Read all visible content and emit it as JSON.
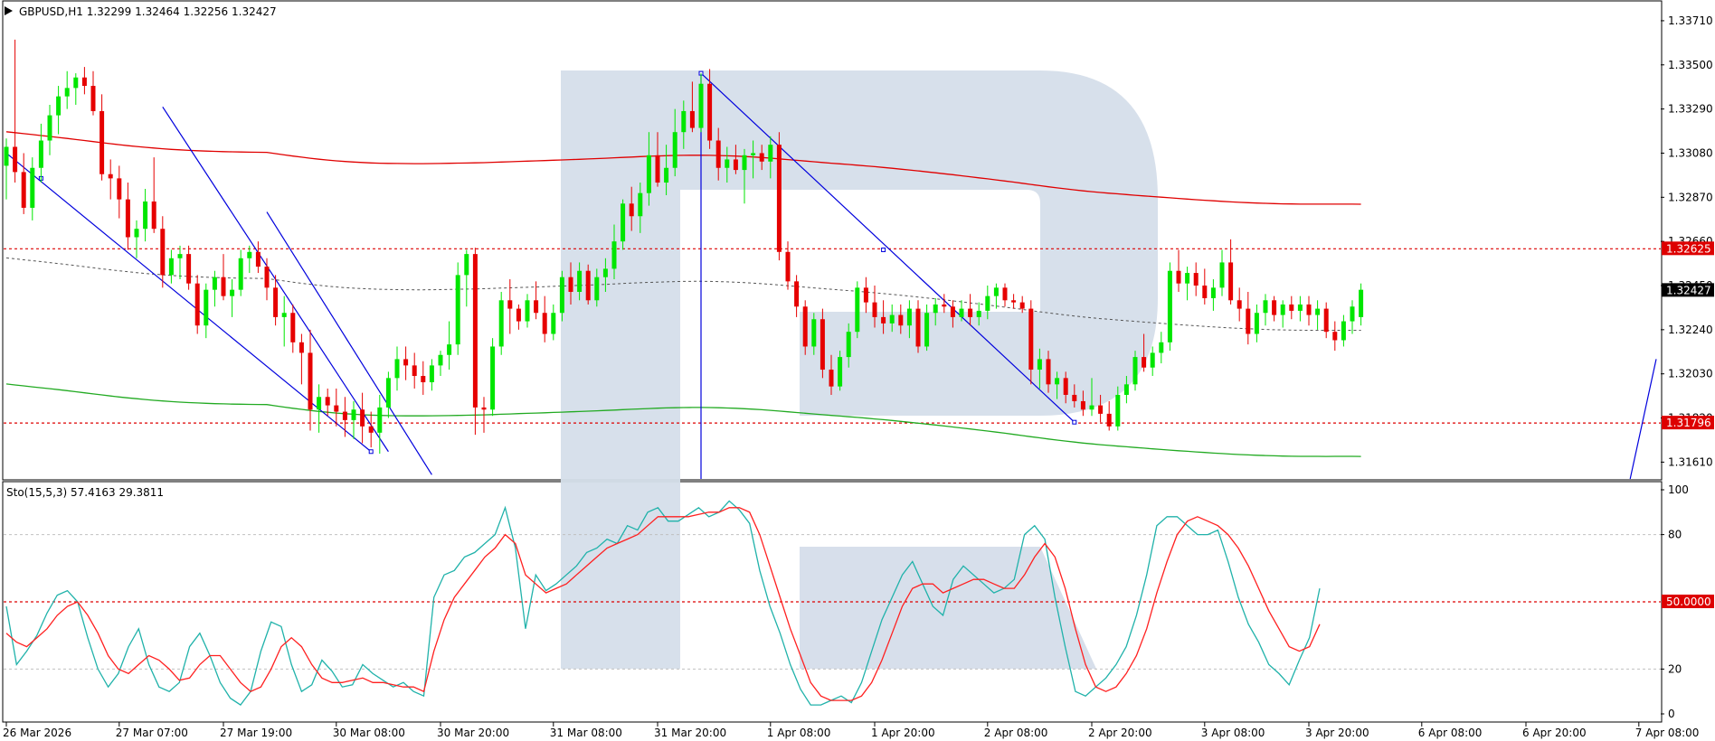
{
  "main_panel": {
    "info_label": "GBPUSD,H1  1.32299 1.32464 1.32256 1.32427",
    "price_ticks": [
      "1.33710",
      "1.33500",
      "1.33290",
      "1.33080",
      "1.32870",
      "1.32660",
      "1.32450",
      "1.32240",
      "1.32030",
      "1.31820",
      "1.31610"
    ],
    "price_levels": [
      1.3371,
      1.335,
      1.3329,
      1.3308,
      1.3287,
      1.3266,
      1.3245,
      1.3224,
      1.3203,
      1.3182,
      1.3161
    ],
    "price_range": [
      1.3153,
      1.338
    ],
    "resistance": {
      "label": "1.32625",
      "value": 1.32625,
      "color": "#dd0000"
    },
    "support": {
      "label": "1.31796",
      "value": 1.31796,
      "color": "#dd0000"
    },
    "current_price": {
      "label": "1.32427",
      "value": 1.32427
    }
  },
  "oscillator_panel": {
    "info_label": "Sto(15,5,3) 57.4163 29.3811",
    "ticks": [
      "100",
      "80",
      "20",
      "0"
    ],
    "tick_values": [
      100,
      80,
      20,
      0
    ],
    "midline": {
      "label": "50.0000",
      "value": 50
    }
  },
  "time_axis": {
    "labels": [
      "26 Mar 2026",
      "27 Mar 07:00",
      "27 Mar 19:00",
      "30 Mar 08:00",
      "30 Mar 20:00",
      "31 Mar 08:00",
      "31 Mar 20:00",
      "1 Apr 08:00",
      "1 Apr 20:00",
      "2 Apr 08:00",
      "2 Apr 20:00",
      "3 Apr 08:00",
      "3 Apr 20:00",
      "6 Apr 08:00",
      "6 Apr 20:00",
      "7 Apr 08:00"
    ],
    "bar_index": [
      0,
      13,
      25,
      38,
      50,
      63,
      75,
      88,
      100,
      113,
      125,
      138,
      150,
      163,
      175,
      188
    ]
  },
  "colors": {
    "bull": "#00e600",
    "bear": "#e60000",
    "stoch_main": "#20b2aa",
    "stoch_signal": "#ff2020",
    "upper_band": "#e00000",
    "lower_band": "#22aa22",
    "trend_lines": "#0000dd",
    "watermark": "#d5deea"
  },
  "chart_data": {
    "type": "candlestick",
    "symbol": "GBPUSD",
    "timeframe": "H1",
    "ylim": [
      1.3153,
      1.338
    ],
    "ohlc": [
      [
        1.3302,
        1.3315,
        1.3286,
        1.3311
      ],
      [
        1.3311,
        1.3362,
        1.3294,
        1.3299
      ],
      [
        1.3299,
        1.3308,
        1.3279,
        1.3282
      ],
      [
        1.3282,
        1.3306,
        1.3276,
        1.3301
      ],
      [
        1.3301,
        1.3322,
        1.3294,
        1.3314
      ],
      [
        1.3314,
        1.3331,
        1.3307,
        1.3326
      ],
      [
        1.3326,
        1.334,
        1.3317,
        1.3335
      ],
      [
        1.3335,
        1.3347,
        1.3329,
        1.3339
      ],
      [
        1.3339,
        1.3346,
        1.3331,
        1.3344
      ],
      [
        1.3344,
        1.3349,
        1.3336,
        1.334
      ],
      [
        1.334,
        1.3347,
        1.3326,
        1.3328
      ],
      [
        1.3328,
        1.3336,
        1.3295,
        1.3298
      ],
      [
        1.3298,
        1.3305,
        1.3286,
        1.3296
      ],
      [
        1.3296,
        1.3302,
        1.3277,
        1.3286
      ],
      [
        1.3286,
        1.3294,
        1.3262,
        1.3268
      ],
      [
        1.3268,
        1.3276,
        1.3258,
        1.3272
      ],
      [
        1.3272,
        1.3291,
        1.3266,
        1.3285
      ],
      [
        1.3285,
        1.3306,
        1.327,
        1.3272
      ],
      [
        1.3272,
        1.3278,
        1.3244,
        1.325
      ],
      [
        1.325,
        1.3262,
        1.3246,
        1.3258
      ],
      [
        1.3258,
        1.3264,
        1.3248,
        1.326
      ],
      [
        1.326,
        1.3264,
        1.3243,
        1.3246
      ],
      [
        1.3246,
        1.325,
        1.3222,
        1.3226
      ],
      [
        1.3226,
        1.3246,
        1.322,
        1.3243
      ],
      [
        1.3243,
        1.3252,
        1.3235,
        1.3249
      ],
      [
        1.3249,
        1.326,
        1.3238,
        1.324
      ],
      [
        1.324,
        1.3248,
        1.323,
        1.3243
      ],
      [
        1.3243,
        1.3262,
        1.324,
        1.3258
      ],
      [
        1.3258,
        1.3264,
        1.3251,
        1.3261
      ],
      [
        1.3261,
        1.3266,
        1.3251,
        1.3254
      ],
      [
        1.3254,
        1.3258,
        1.3238,
        1.3244
      ],
      [
        1.3244,
        1.325,
        1.3226,
        1.323
      ],
      [
        1.323,
        1.324,
        1.3216,
        1.3232
      ],
      [
        1.3232,
        1.3236,
        1.3213,
        1.3218
      ],
      [
        1.3218,
        1.3222,
        1.3198,
        1.3213
      ],
      [
        1.3213,
        1.3224,
        1.3176,
        1.3186
      ],
      [
        1.3186,
        1.3198,
        1.3175,
        1.3192
      ],
      [
        1.3192,
        1.3196,
        1.3183,
        1.3188
      ],
      [
        1.3188,
        1.3196,
        1.3178,
        1.3185
      ],
      [
        1.3185,
        1.3192,
        1.3173,
        1.3181
      ],
      [
        1.3181,
        1.319,
        1.3172,
        1.3186
      ],
      [
        1.3186,
        1.3194,
        1.317,
        1.3178
      ],
      [
        1.3178,
        1.3185,
        1.3168,
        1.3175
      ],
      [
        1.3175,
        1.3193,
        1.3165,
        1.3187
      ],
      [
        1.3187,
        1.3204,
        1.3182,
        1.3201
      ],
      [
        1.3201,
        1.3216,
        1.3195,
        1.321
      ],
      [
        1.321,
        1.3216,
        1.32,
        1.3207
      ],
      [
        1.3207,
        1.3213,
        1.3196,
        1.3202
      ],
      [
        1.3202,
        1.3209,
        1.3193,
        1.3199
      ],
      [
        1.3199,
        1.321,
        1.3195,
        1.3207
      ],
      [
        1.3207,
        1.3214,
        1.3202,
        1.3212
      ],
      [
        1.3212,
        1.3228,
        1.3205,
        1.3217
      ],
      [
        1.3217,
        1.3256,
        1.3212,
        1.325
      ],
      [
        1.325,
        1.3262,
        1.3235,
        1.326
      ],
      [
        1.326,
        1.3263,
        1.3174,
        1.3187
      ],
      [
        1.3187,
        1.3192,
        1.3175,
        1.3186
      ],
      [
        1.3186,
        1.322,
        1.3183,
        1.3216
      ],
      [
        1.3216,
        1.3242,
        1.3212,
        1.3238
      ],
      [
        1.3238,
        1.3248,
        1.3222,
        1.3234
      ],
      [
        1.3234,
        1.3236,
        1.3224,
        1.3228
      ],
      [
        1.3228,
        1.3241,
        1.3225,
        1.3238
      ],
      [
        1.3238,
        1.3247,
        1.3229,
        1.3232
      ],
      [
        1.3232,
        1.324,
        1.3218,
        1.3222
      ],
      [
        1.3222,
        1.3236,
        1.3219,
        1.3232
      ],
      [
        1.3232,
        1.3252,
        1.3228,
        1.3249
      ],
      [
        1.3249,
        1.3256,
        1.3236,
        1.3242
      ],
      [
        1.3242,
        1.3256,
        1.3238,
        1.3252
      ],
      [
        1.3252,
        1.3255,
        1.3236,
        1.3238
      ],
      [
        1.3238,
        1.3253,
        1.3235,
        1.3249
      ],
      [
        1.3249,
        1.3258,
        1.3242,
        1.3253
      ],
      [
        1.3253,
        1.3274,
        1.3248,
        1.3266
      ],
      [
        1.3266,
        1.3286,
        1.3262,
        1.3284
      ],
      [
        1.3284,
        1.3292,
        1.3271,
        1.3278
      ],
      [
        1.3278,
        1.3294,
        1.327,
        1.3289
      ],
      [
        1.3289,
        1.3318,
        1.3283,
        1.3307
      ],
      [
        1.3307,
        1.3318,
        1.3292,
        1.3294
      ],
      [
        1.3294,
        1.3312,
        1.3288,
        1.3301
      ],
      [
        1.3301,
        1.3329,
        1.3297,
        1.3318
      ],
      [
        1.3318,
        1.3333,
        1.331,
        1.3328
      ],
      [
        1.3328,
        1.3342,
        1.3318,
        1.332
      ],
      [
        1.332,
        1.3346,
        1.3318,
        1.3341
      ],
      [
        1.3341,
        1.3348,
        1.331,
        1.3314
      ],
      [
        1.3314,
        1.332,
        1.3295,
        1.3301
      ],
      [
        1.3301,
        1.3311,
        1.3294,
        1.3305
      ],
      [
        1.3305,
        1.3312,
        1.3298,
        1.33
      ],
      [
        1.33,
        1.331,
        1.3284,
        1.3307
      ],
      [
        1.3307,
        1.3314,
        1.3296,
        1.3308
      ],
      [
        1.3308,
        1.3312,
        1.33,
        1.3304
      ],
      [
        1.3304,
        1.3316,
        1.3296,
        1.3312
      ],
      [
        1.3312,
        1.3318,
        1.3257,
        1.3261
      ],
      [
        1.3261,
        1.3266,
        1.3243,
        1.3247
      ],
      [
        1.3247,
        1.325,
        1.323,
        1.3235
      ],
      [
        1.3235,
        1.3238,
        1.3212,
        1.3216
      ],
      [
        1.3216,
        1.3232,
        1.3212,
        1.3229
      ],
      [
        1.3229,
        1.3234,
        1.3201,
        1.3205
      ],
      [
        1.3205,
        1.3212,
        1.3193,
        1.3197
      ],
      [
        1.3197,
        1.3214,
        1.3195,
        1.3211
      ],
      [
        1.3211,
        1.3227,
        1.3206,
        1.3223
      ],
      [
        1.3223,
        1.3247,
        1.322,
        1.3244
      ],
      [
        1.3244,
        1.3249,
        1.3232,
        1.3237
      ],
      [
        1.3237,
        1.3245,
        1.3225,
        1.323
      ],
      [
        1.323,
        1.3238,
        1.3222,
        1.3227
      ],
      [
        1.3227,
        1.3236,
        1.3223,
        1.3231
      ],
      [
        1.3231,
        1.3236,
        1.3222,
        1.3226
      ],
      [
        1.3226,
        1.3238,
        1.322,
        1.3234
      ],
      [
        1.3234,
        1.3238,
        1.3213,
        1.3216
      ],
      [
        1.3216,
        1.3236,
        1.3214,
        1.3232
      ],
      [
        1.3232,
        1.3239,
        1.3226,
        1.3236
      ],
      [
        1.3236,
        1.3241,
        1.3232,
        1.3235
      ],
      [
        1.3235,
        1.3238,
        1.3225,
        1.323
      ],
      [
        1.323,
        1.3238,
        1.3228,
        1.3234
      ],
      [
        1.3234,
        1.3241,
        1.3226,
        1.323
      ],
      [
        1.323,
        1.3237,
        1.3226,
        1.3233
      ],
      [
        1.3233,
        1.3245,
        1.3229,
        1.324
      ],
      [
        1.324,
        1.3246,
        1.3234,
        1.3244
      ],
      [
        1.3244,
        1.3246,
        1.3235,
        1.3238
      ],
      [
        1.3238,
        1.3241,
        1.3234,
        1.3237
      ],
      [
        1.3237,
        1.324,
        1.3232,
        1.3234
      ],
      [
        1.3234,
        1.3238,
        1.3198,
        1.3205
      ],
      [
        1.3205,
        1.3215,
        1.3196,
        1.321
      ],
      [
        1.321,
        1.3214,
        1.3194,
        1.3198
      ],
      [
        1.3198,
        1.3204,
        1.3191,
        1.3201
      ],
      [
        1.3201,
        1.3204,
        1.3189,
        1.3193
      ],
      [
        1.3193,
        1.3198,
        1.3187,
        1.319
      ],
      [
        1.319,
        1.3195,
        1.3183,
        1.3186
      ],
      [
        1.3186,
        1.3201,
        1.3183,
        1.3188
      ],
      [
        1.3188,
        1.3193,
        1.318,
        1.3184
      ],
      [
        1.3184,
        1.319,
        1.3176,
        1.3178
      ],
      [
        1.3178,
        1.3197,
        1.3176,
        1.3193
      ],
      [
        1.3193,
        1.3202,
        1.3189,
        1.3198
      ],
      [
        1.3198,
        1.3214,
        1.3195,
        1.3211
      ],
      [
        1.3211,
        1.3222,
        1.3204,
        1.3206
      ],
      [
        1.3206,
        1.3216,
        1.3202,
        1.3213
      ],
      [
        1.3213,
        1.3223,
        1.3208,
        1.3218
      ],
      [
        1.3218,
        1.3256,
        1.3214,
        1.3252
      ],
      [
        1.3252,
        1.3262,
        1.3242,
        1.3246
      ],
      [
        1.3246,
        1.3254,
        1.3238,
        1.3251
      ],
      [
        1.3251,
        1.3256,
        1.324,
        1.3245
      ],
      [
        1.3245,
        1.3253,
        1.3236,
        1.3239
      ],
      [
        1.3239,
        1.3248,
        1.3233,
        1.3244
      ],
      [
        1.3244,
        1.3262,
        1.324,
        1.3256
      ],
      [
        1.3256,
        1.3267,
        1.3236,
        1.3238
      ],
      [
        1.3238,
        1.3244,
        1.3228,
        1.3234
      ],
      [
        1.3234,
        1.3242,
        1.3217,
        1.3222
      ],
      [
        1.3222,
        1.3236,
        1.3218,
        1.3232
      ],
      [
        1.3232,
        1.3241,
        1.3226,
        1.3238
      ],
      [
        1.3238,
        1.324,
        1.3228,
        1.3231
      ],
      [
        1.3231,
        1.3238,
        1.3225,
        1.3236
      ],
      [
        1.3236,
        1.324,
        1.3229,
        1.3233
      ],
      [
        1.3233,
        1.324,
        1.3228,
        1.3236
      ],
      [
        1.3236,
        1.324,
        1.3226,
        1.3231
      ],
      [
        1.3231,
        1.3238,
        1.3224,
        1.3234
      ],
      [
        1.3234,
        1.3237,
        1.322,
        1.3223
      ],
      [
        1.3223,
        1.3228,
        1.3214,
        1.3219
      ],
      [
        1.3219,
        1.3231,
        1.3216,
        1.3228
      ],
      [
        1.3228,
        1.3238,
        1.3222,
        1.3235
      ],
      [
        1.323,
        1.3246,
        1.3226,
        1.3243
      ]
    ],
    "stochastic": {
      "main": [
        48,
        22,
        28,
        35,
        45,
        53,
        55,
        50,
        34,
        20,
        12,
        18,
        30,
        38,
        22,
        12,
        10,
        14,
        30,
        36,
        26,
        14,
        7,
        4,
        10,
        28,
        41,
        39,
        22,
        10,
        13,
        24,
        19,
        12,
        13,
        22,
        18,
        15,
        12,
        14,
        10,
        8,
        52,
        62,
        64,
        70,
        72,
        76,
        80,
        92,
        74,
        38,
        62,
        55,
        58,
        62,
        66,
        72,
        74,
        78,
        76,
        84,
        82,
        90,
        92,
        86,
        86,
        89,
        92,
        88,
        90,
        95,
        91,
        85,
        64,
        48,
        36,
        22,
        11,
        4,
        4,
        6,
        8,
        5,
        14,
        28,
        42,
        52,
        62,
        68,
        58,
        48,
        44,
        60,
        66,
        62,
        58,
        54,
        56,
        60,
        80,
        84,
        78,
        52,
        30,
        10,
        8,
        12,
        16,
        22,
        30,
        44,
        62,
        84,
        88,
        88,
        84,
        80,
        80,
        82,
        68,
        52,
        40,
        32,
        22,
        18,
        13,
        24,
        34,
        56
      ],
      "signal": [
        36,
        32,
        30,
        34,
        38,
        44,
        48,
        50,
        44,
        36,
        26,
        20,
        18,
        22,
        26,
        24,
        20,
        15,
        16,
        22,
        26,
        26,
        20,
        14,
        10,
        12,
        20,
        30,
        34,
        30,
        22,
        16,
        14,
        14,
        15,
        16,
        14,
        14,
        13,
        12,
        12,
        10,
        28,
        42,
        52,
        58,
        64,
        70,
        74,
        80,
        76,
        62,
        58,
        54,
        56,
        58,
        62,
        66,
        70,
        74,
        76,
        78,
        80,
        84,
        88,
        88,
        88,
        88,
        89,
        90,
        90,
        92,
        92,
        90,
        80,
        66,
        52,
        38,
        26,
        14,
        8,
        6,
        6,
        6,
        8,
        14,
        24,
        36,
        48,
        56,
        58,
        58,
        54,
        56,
        58,
        60,
        60,
        58,
        56,
        56,
        62,
        70,
        76,
        70,
        56,
        38,
        22,
        12,
        10,
        12,
        18,
        26,
        38,
        54,
        68,
        80,
        86,
        88,
        86,
        84,
        80,
        74,
        66,
        56,
        46,
        38,
        30,
        28,
        30,
        40
      ]
    }
  }
}
